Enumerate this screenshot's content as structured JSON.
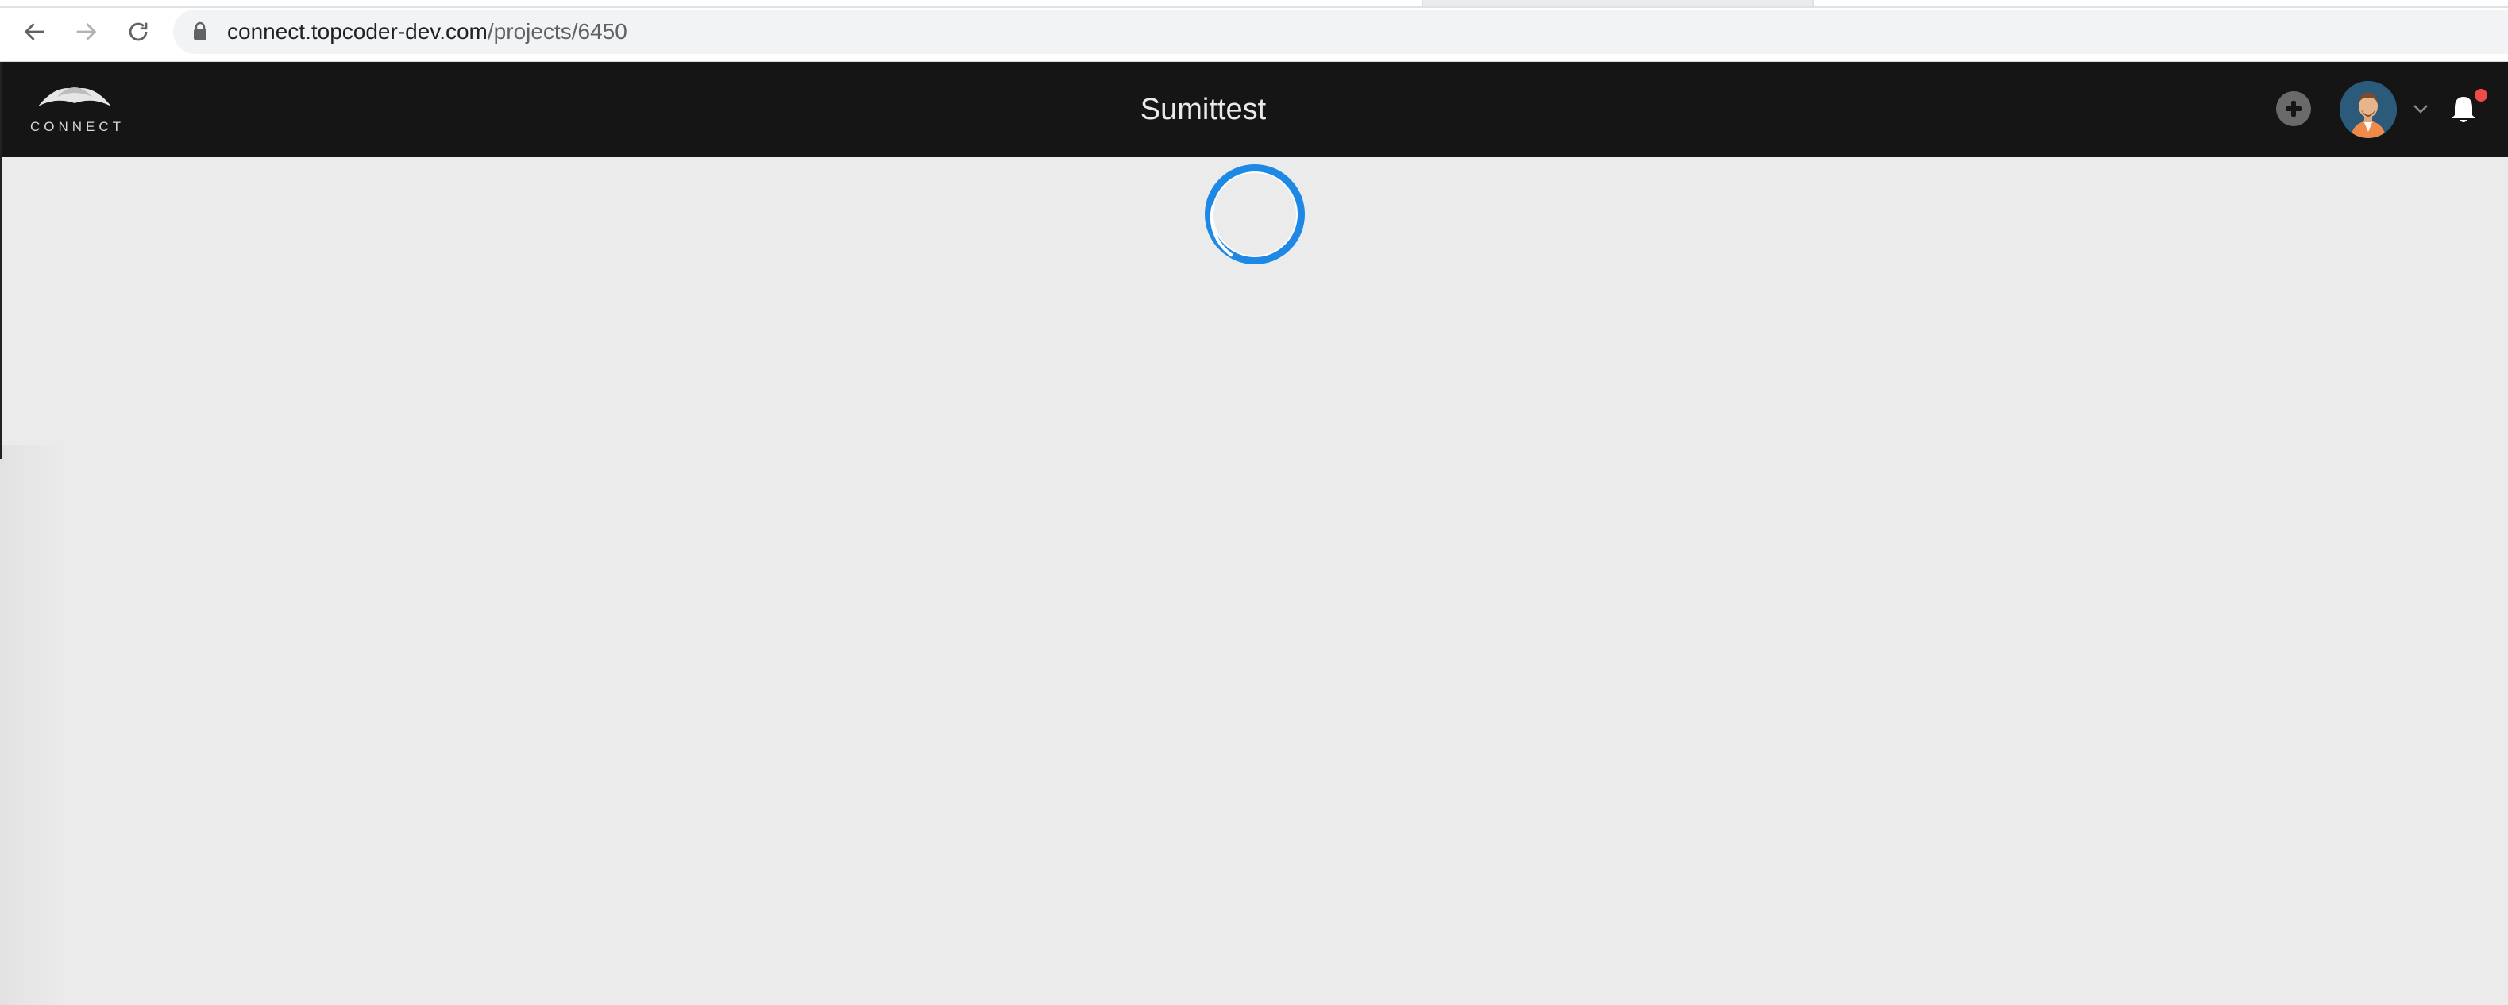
{
  "browser": {
    "url_host": "connect.topcoder-dev.com",
    "url_path": "/projects/6450",
    "icons": [
      "back-arrow-icon",
      "forward-arrow-icon",
      "reload-icon",
      "lock-icon"
    ]
  },
  "header": {
    "logo_text": "CONNECT",
    "title": "Sumittest",
    "icons": [
      "add-icon",
      "avatar",
      "chevron-down-icon",
      "bell-icon"
    ],
    "notification_color": "#ef4b4b"
  },
  "content": {
    "loading": true,
    "spinner_color": "#1e88e5"
  },
  "colors": {
    "header_bg": "#151515",
    "content_bg": "#ebebeb"
  }
}
